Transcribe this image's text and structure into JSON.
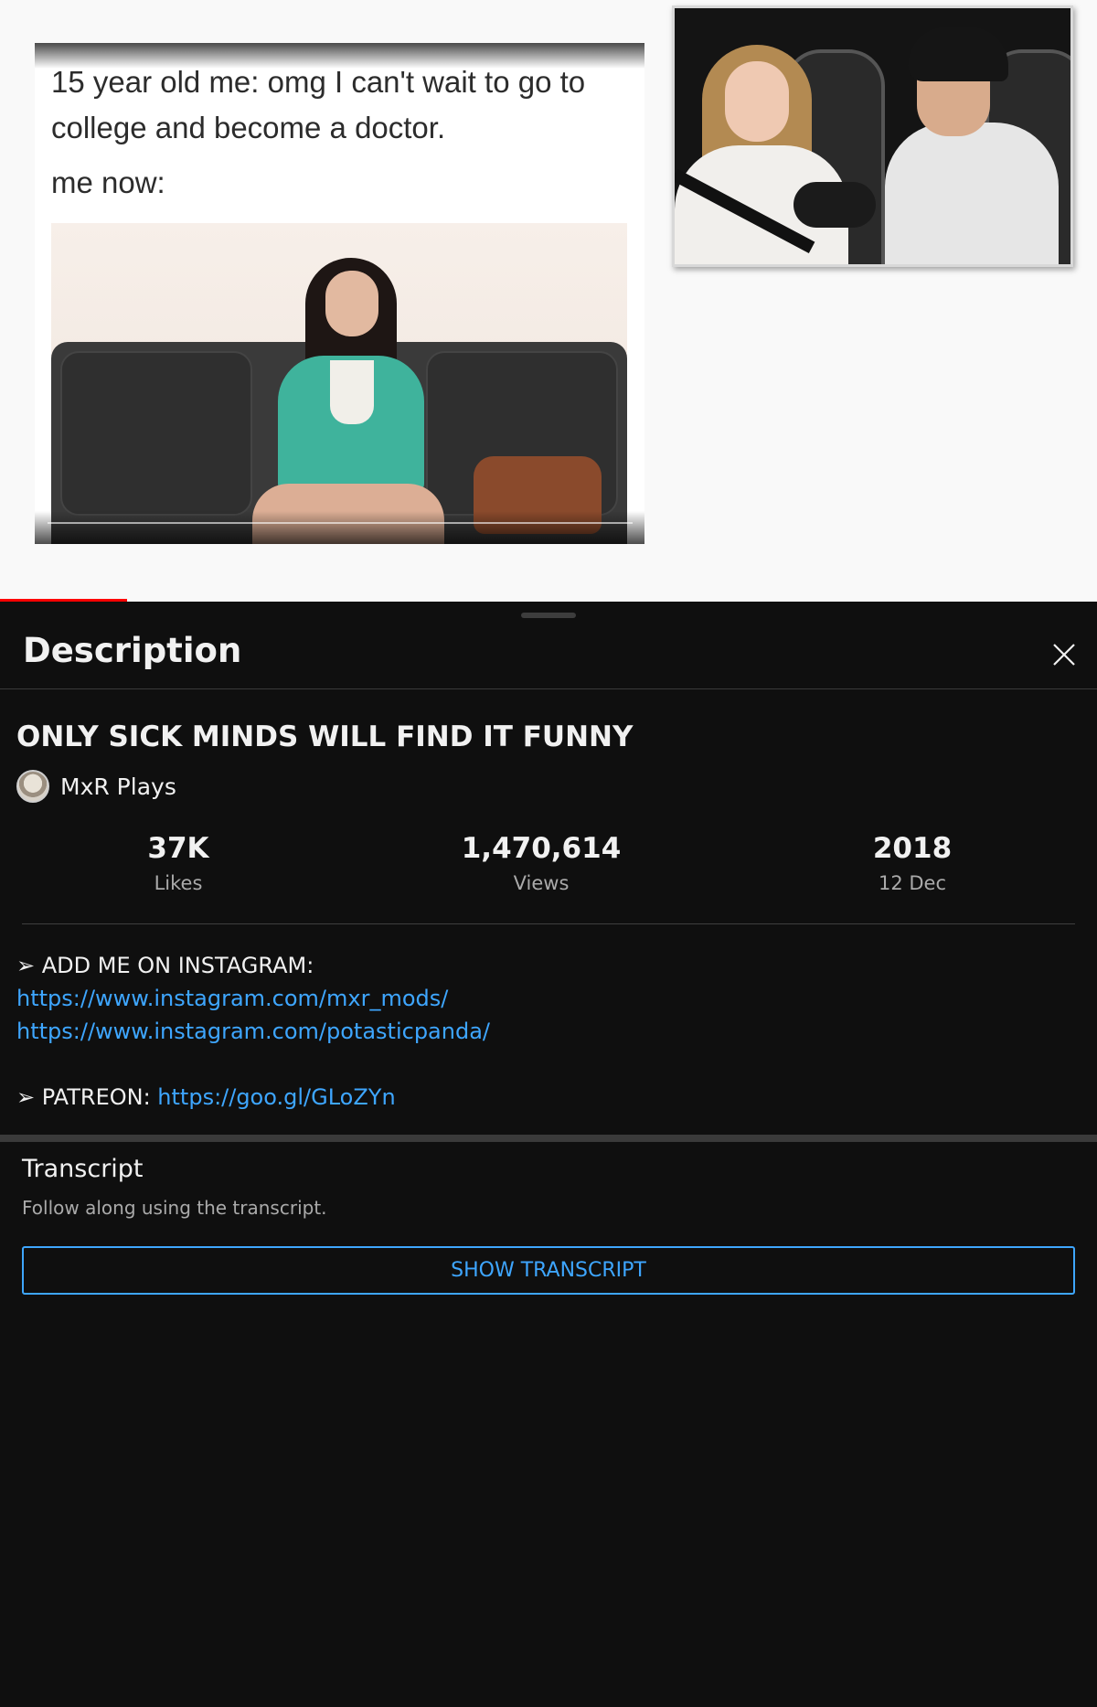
{
  "player": {
    "meme_caption_line1": "15 year old me: omg I can't wait to go to",
    "meme_caption_line2": "college and become a doctor.",
    "meme_caption_line3": "me now:",
    "progress_fraction": 0.116,
    "progress_color": "#ff0000"
  },
  "description_panel": {
    "header_title": "Description",
    "close_icon": "close-icon",
    "video_title": "ONLY SICK MINDS WILL FIND IT FUNNY",
    "channel_name": "MxR Plays",
    "stats": {
      "likes_value": "37K",
      "likes_label": "Likes",
      "views_value": "1,470,614",
      "views_label": "Views",
      "year_value": "2018",
      "date_label": "12 Dec"
    },
    "body": {
      "instagram_heading": "➢ ADD ME ON INSTAGRAM:",
      "instagram_link_1": "https://www.instagram.com/mxr_mods/",
      "instagram_link_2": "https://www.instagram.com/potasticpanda/",
      "patreon_prefix": "➢ PATREON: ",
      "patreon_link": "https://goo.gl/GLoZYn"
    },
    "transcript": {
      "title": "Transcript",
      "subtitle": "Follow along using the transcript.",
      "button_label": "SHOW TRANSCRIPT"
    },
    "colors": {
      "background": "#0f0f0f",
      "link": "#3ea6ff",
      "secondary_text": "#aaaaaa"
    }
  }
}
